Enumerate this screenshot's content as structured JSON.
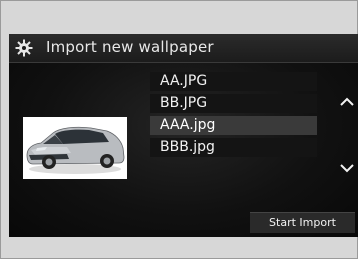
{
  "header": {
    "title": "Import new wallpaper",
    "icon": "settings-gear-icon"
  },
  "preview": {
    "icon": "car-thumbnail-image"
  },
  "files": [
    {
      "name": "AA.JPG",
      "selected": false
    },
    {
      "name": "BB.JPG",
      "selected": false
    },
    {
      "name": "AAA.jpg",
      "selected": true
    },
    {
      "name": "BBB.jpg",
      "selected": false
    }
  ],
  "scroll": {
    "up_icon": "chevron-up-icon",
    "down_icon": "chevron-down-icon"
  },
  "actions": {
    "start_import": "Start Import"
  },
  "colors": {
    "background": "#101010",
    "text": "#f2f2f2",
    "selected_row": "#3a3a3a"
  }
}
